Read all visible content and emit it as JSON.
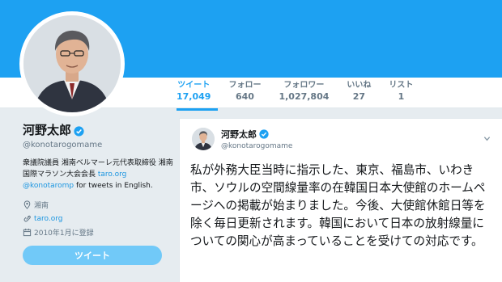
{
  "profile": {
    "name": "河野太郎",
    "handle": "@konotarogomame",
    "bio_text": "衆議院議員 湘南ベルマーレ元代表取締役 湘南国際マラソン大会会長 ",
    "bio_link1": "taro.org",
    "bio_link2": "@konotaromp",
    "bio_suffix": " for tweets in English.",
    "location": "湘南",
    "website": "taro.org",
    "joined": "2010年1月に登録",
    "tweet_button": "ツイート"
  },
  "stats": [
    {
      "label": "ツイート",
      "value": "17,049"
    },
    {
      "label": "フォロー",
      "value": "640"
    },
    {
      "label": "フォロワー",
      "value": "1,027,804"
    },
    {
      "label": "いいね",
      "value": "27"
    },
    {
      "label": "リスト",
      "value": "1"
    }
  ],
  "tweet": {
    "name": "河野太郎",
    "handle": "@konotarogomame",
    "text": "私が外務大臣当時に指示した、東京、福島市、いわき市、ソウルの空間線量率の在韓国日本大使館のホームページへの掲載が始まりました。今後、大使館休館日等を除く毎日更新されます。韓国において日本の放射線量についての関心が高まっていることを受けての対応です。"
  },
  "colors": {
    "brand": "#1da1f2",
    "link": "#1b95e0",
    "muted": "#657786",
    "button_disabled": "#71c9f8"
  },
  "icons": [
    "verified-badge-icon",
    "location-pin-icon",
    "link-icon",
    "calendar-icon",
    "chevron-down-icon"
  ]
}
